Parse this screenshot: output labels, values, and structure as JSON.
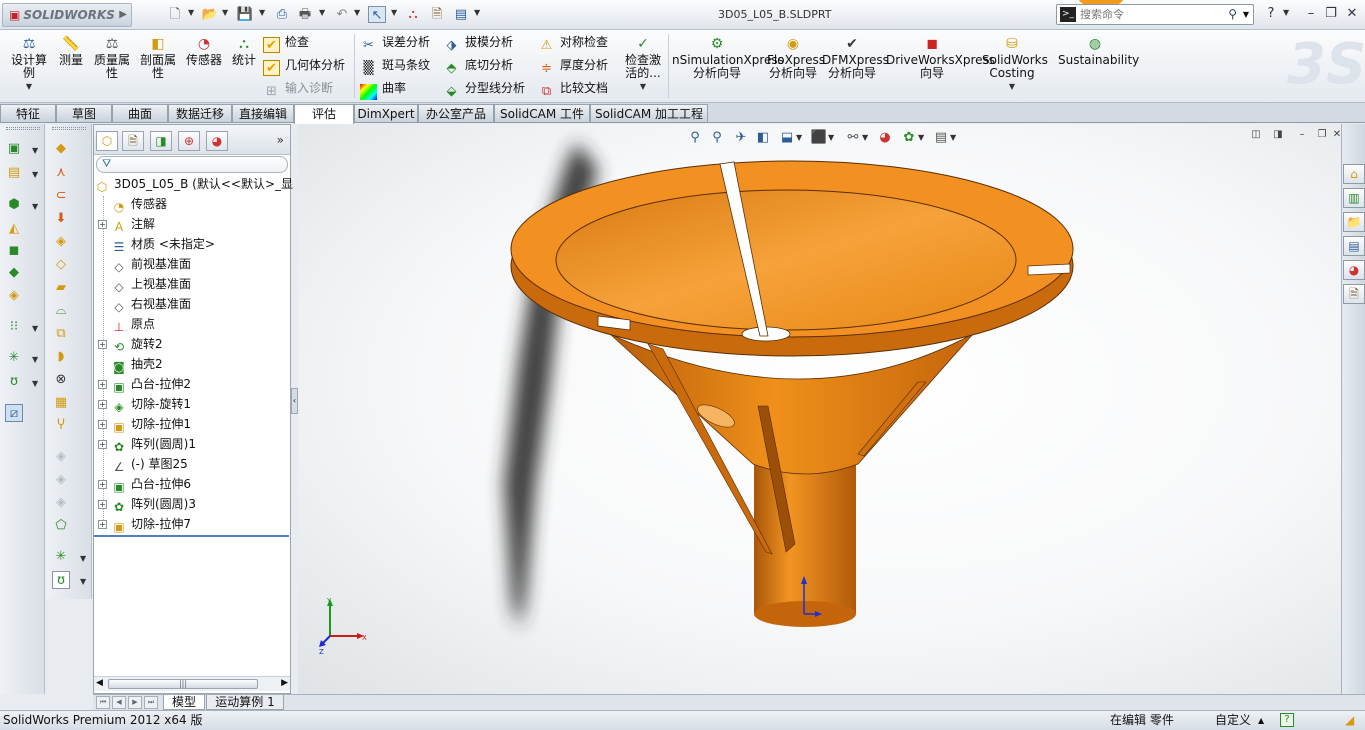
{
  "app": {
    "logo": "SOLIDWORKS",
    "document_title": "3D05_L05_B.SLDPRT",
    "search_placeholder": "搜索命令",
    "help_icon": "?"
  },
  "ribbon": {
    "big_buttons": [
      {
        "id": "design-study",
        "label": "设计算例",
        "icon": "design-study-icon"
      },
      {
        "id": "measure",
        "label": "测量",
        "icon": "measure-icon"
      },
      {
        "id": "mass-properties",
        "label": "质量属性",
        "icon": "mass-properties-icon"
      },
      {
        "id": "section-properties",
        "label": "剖面属性",
        "icon": "section-properties-icon"
      },
      {
        "id": "sensor",
        "label": "传感器",
        "icon": "sensor-icon"
      },
      {
        "id": "statistics",
        "label": "统计",
        "icon": "statistics-icon"
      },
      {
        "id": "check-active",
        "label": "检查激活的...",
        "icon": "check-active-icon"
      },
      {
        "id": "simulationxpress",
        "label": "nSimulationXpress 分析向导",
        "icon": "simulationxpress-icon"
      },
      {
        "id": "floxpress",
        "label": "FloXpress 分析向导",
        "icon": "floxpress-icon"
      },
      {
        "id": "dfmxpress",
        "label": "DFMXpress 分析向导",
        "icon": "dfmxpress-icon"
      },
      {
        "id": "driveworksxpress",
        "label": "DriveWorksXpress 向导",
        "icon": "driveworksxpress-icon"
      },
      {
        "id": "costing",
        "label": "SolidWorks Costing",
        "icon": "costing-icon"
      },
      {
        "id": "sustainability",
        "label": "Sustainability",
        "icon": "sustainability-icon"
      }
    ],
    "check": "检查",
    "geometry_analysis": "几何体分析",
    "import_diagnostics": "输入诊断",
    "deviation_analysis": "误差分析",
    "zebra_stripes": "斑马条纹",
    "curvature": "曲率",
    "draft_analysis": "拔模分析",
    "undercut_analysis": "底切分析",
    "parting_line_analysis": "分型线分析",
    "symmetry_check": "对称检查",
    "thickness_analysis": "厚度分析",
    "compare_documents": "比较文档"
  },
  "tabs": [
    "特征",
    "草图",
    "曲面",
    "数据迁移",
    "直接编辑",
    "评估",
    "DimXpert",
    "办公室产品",
    "SolidCAM 工件",
    "SolidCAM 加工工程"
  ],
  "active_tab": "评估",
  "feature_tree": {
    "root": "3D05_L05_B (默认<<默认>_显",
    "items": [
      {
        "label": "传感器",
        "icon": "sensor-folder-icon",
        "expand": false
      },
      {
        "label": "注解",
        "icon": "annotations-icon",
        "expand": true
      },
      {
        "label": "材质 <未指定>",
        "icon": "material-icon",
        "expand": false
      },
      {
        "label": "前视基准面",
        "icon": "plane-icon",
        "expand": false
      },
      {
        "label": "上视基准面",
        "icon": "plane-icon",
        "expand": false
      },
      {
        "label": "右视基准面",
        "icon": "plane-icon",
        "expand": false
      },
      {
        "label": "原点",
        "icon": "origin-icon",
        "expand": false
      },
      {
        "label": "旋转2",
        "icon": "revolve-icon",
        "expand": true
      },
      {
        "label": "抽壳2",
        "icon": "shell-icon",
        "expand": false
      },
      {
        "label": "凸台-拉伸2",
        "icon": "boss-extrude-icon",
        "expand": true
      },
      {
        "label": "切除-旋转1",
        "icon": "cut-revolve-icon",
        "expand": true
      },
      {
        "label": "切除-拉伸1",
        "icon": "cut-extrude-icon",
        "expand": true
      },
      {
        "label": "阵列(圆周)1",
        "icon": "circular-pattern-icon",
        "expand": true
      },
      {
        "label": "(-) 草图25",
        "icon": "sketch-icon",
        "expand": false
      },
      {
        "label": "凸台-拉伸6",
        "icon": "boss-extrude-icon",
        "expand": true
      },
      {
        "label": "阵列(圆周)3",
        "icon": "circular-pattern-icon",
        "expand": true
      },
      {
        "label": "切除-拉伸7",
        "icon": "cut-extrude-icon",
        "expand": true
      }
    ]
  },
  "bottom_tabs": [
    "模型",
    "运动算例 1"
  ],
  "status": {
    "product": "SolidWorks Premium 2012 x64 版",
    "editing": "在编辑 零件",
    "units": "自定义"
  },
  "colors": {
    "part_orange": "#f08a14",
    "part_dark": "#c96a0c",
    "accent_blue": "#2e5d96"
  }
}
